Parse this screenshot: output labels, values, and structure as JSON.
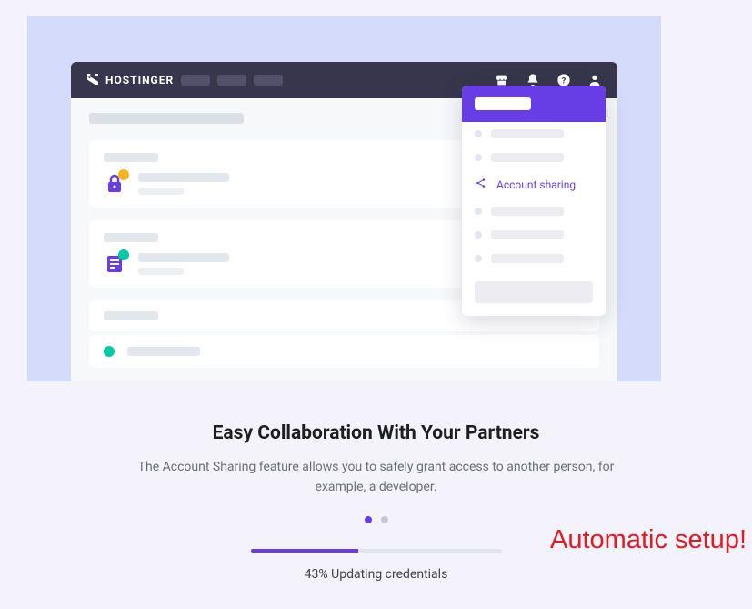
{
  "brand_name": "HOSTINGER",
  "dropdown": {
    "highlighted_label": "Account sharing"
  },
  "headline": "Easy Collaboration With Your Partners",
  "subtext": "The Account Sharing feature allows you to safely grant access to another person, for example, a developer.",
  "progress": {
    "percent": 43,
    "label": "43% Updating credentials"
  },
  "overlay": "Automatic setup!",
  "colors": {
    "accent": "#673de6",
    "panel_bg": "#d5dbfb",
    "page_bg": "#f4f3fb",
    "topbar": "#38364c"
  }
}
